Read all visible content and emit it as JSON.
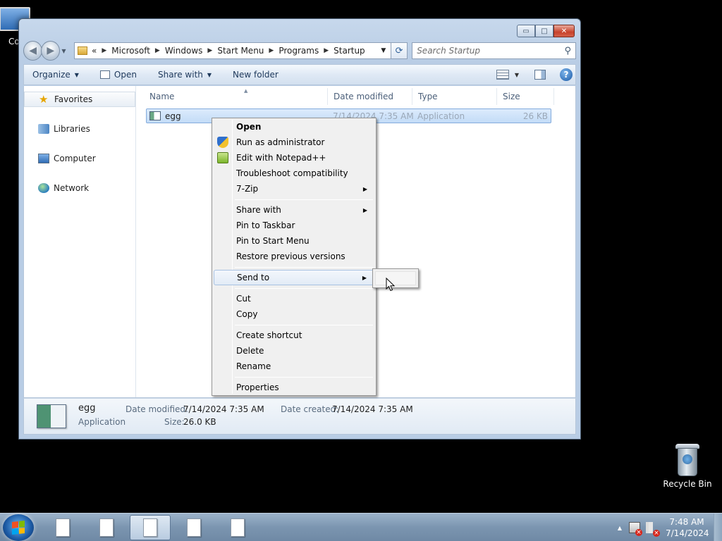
{
  "desktop": {
    "computer_label": "Co",
    "recycle_bin_label": "Recycle Bin"
  },
  "window": {
    "address_crumbs": [
      "Microsoft",
      "Windows",
      "Start Menu",
      "Programs",
      "Startup"
    ],
    "address_overflow": "«",
    "search_placeholder": "Search Startup",
    "toolbar": {
      "organize": "Organize",
      "open": "Open",
      "share_with": "Share with",
      "new_folder": "New folder"
    },
    "nav_pane": [
      {
        "label": "Favorites",
        "icon": "star-icon"
      },
      {
        "label": "Libraries",
        "icon": "libraries-icon"
      },
      {
        "label": "Computer",
        "icon": "computer-icon"
      },
      {
        "label": "Network",
        "icon": "network-icon"
      }
    ],
    "columns": [
      "Name",
      "Date modified",
      "Type",
      "Size"
    ],
    "files": [
      {
        "name": "egg",
        "date_modified": "7/14/2024 7:35 AM",
        "type": "Application",
        "size": "26 KB"
      }
    ],
    "details": {
      "name": "egg",
      "type": "Application",
      "date_modified_label": "Date modified:",
      "date_modified": "7/14/2024 7:35 AM",
      "date_created_label": "Date created:",
      "date_created": "7/14/2024 7:35 AM",
      "size_label": "Size:",
      "size": "26.0 KB"
    }
  },
  "context_menu": {
    "items": [
      "Open",
      "Run as administrator",
      "Edit with Notepad++",
      "Troubleshoot compatibility",
      "7-Zip",
      "Share with",
      "Pin to Taskbar",
      "Pin to Start Menu",
      "Restore previous versions",
      "Send to",
      "Cut",
      "Copy",
      "Create shortcut",
      "Delete",
      "Rename",
      "Properties"
    ],
    "highlighted": "Send to"
  },
  "taskbar": {
    "time": "7:48 AM",
    "date": "7/14/2024"
  }
}
